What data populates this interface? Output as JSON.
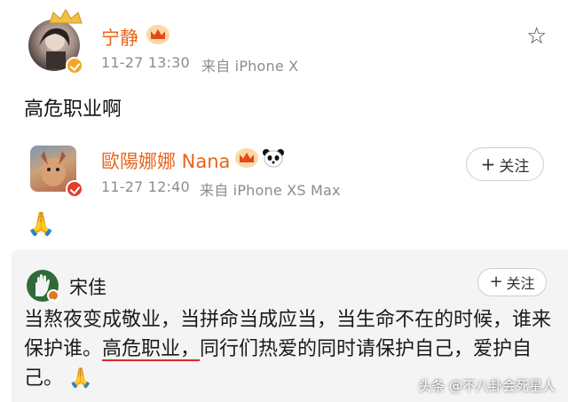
{
  "post": {
    "author": "宁静",
    "time": "11-27 13:30",
    "source": "来自 iPhone X",
    "text": "高危职业啊"
  },
  "reply": {
    "author": "歐陽娜娜 Nana",
    "time": "11-27 12:40",
    "source": "来自 iPhone XS Max",
    "follow_label": "关注",
    "emoji": "🙏"
  },
  "comment": {
    "author": "宋佳",
    "follow_label": "关注",
    "text_before": "当熬夜变成敬业，当拼命当成应当，当生命不在的时候，谁来保护谁。",
    "text_underlined": "高危职业，",
    "text_after": "同行们热爱的同时请保护自己，爱护自己。",
    "emoji": "🙏"
  },
  "watermark": "头条 @不八卦会死星人",
  "colors": {
    "name_orange": "#e8641b",
    "meta_gray": "#8c8c8c",
    "comment_bg": "#f4f4f4",
    "underline_red": "#d9282f"
  }
}
